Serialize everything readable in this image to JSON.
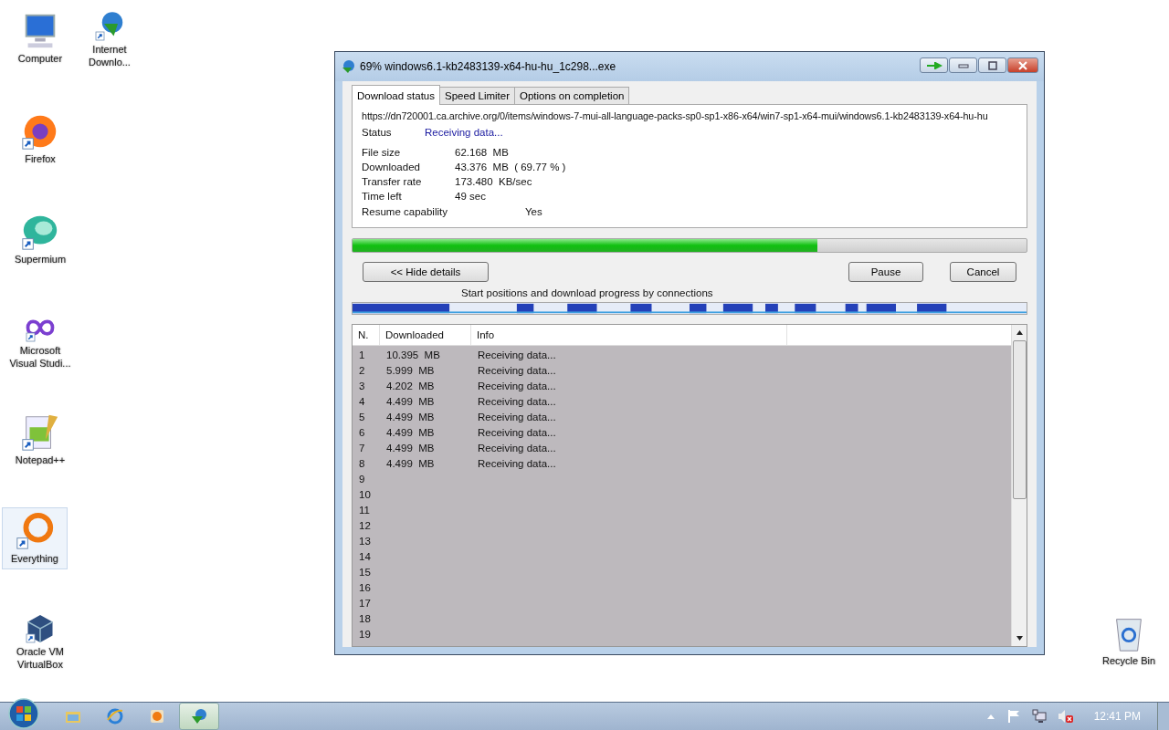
{
  "desktop_icons": [
    {
      "label": "Computer",
      "kind": "computer",
      "selected": false
    },
    {
      "label": "Internet Downlo...",
      "kind": "globe",
      "selected": false
    },
    {
      "label": "Firefox",
      "kind": "firefox",
      "selected": false
    },
    {
      "label": "Supermium",
      "kind": "supermium",
      "selected": false
    },
    {
      "label": "Microsoft Visual Studi...",
      "kind": "infinity",
      "selected": false
    },
    {
      "label": "Notepad++",
      "kind": "notepad",
      "selected": false
    },
    {
      "label": "Everything",
      "kind": "ring",
      "selected": true
    },
    {
      "label": "Oracle VM VirtualBox",
      "kind": "cube",
      "selected": false
    },
    {
      "label": "Recycle Bin",
      "kind": "bin",
      "selected": false
    }
  ],
  "window": {
    "title": "69% windows6.1-kb2483139-x64-hu-hu_1c298...exe"
  },
  "tabs": [
    {
      "label": "Download status",
      "selected": true
    },
    {
      "label": "Speed Limiter",
      "selected": false
    },
    {
      "label": "Options on completion",
      "selected": false
    }
  ],
  "url": "https://dn720001.ca.archive.org/0/items/windows-7-mui-all-language-packs-sp0-sp1-x86-x64/win7-sp1-x64-mui/windows6.1-kb2483139-x64-hu-hu",
  "status": {
    "label": "Status",
    "value": "Receiving data..."
  },
  "details": [
    {
      "label": "File size",
      "value": "62.168  MB"
    },
    {
      "label": "Downloaded",
      "value": "43.376  MB  ( 69.77 % )"
    },
    {
      "label": "Transfer rate",
      "value": "173.480  KB/sec"
    },
    {
      "label": "Time left",
      "value": "49 sec"
    }
  ],
  "resume": {
    "label": "Resume capability",
    "value": "Yes"
  },
  "progress": {
    "level": 0.69
  },
  "buttons": {
    "hide_details": "<< Hide details",
    "pause": "Pause",
    "cancel": "Cancel"
  },
  "connections_caption": "Start positions and download progress by connections",
  "table": {
    "columns": [
      "N.",
      "Downloaded",
      "Info"
    ],
    "rows": [
      {
        "n": "1",
        "downloaded": "10.395  MB",
        "info": "Receiving data..."
      },
      {
        "n": "2",
        "downloaded": "5.999  MB",
        "info": "Receiving data..."
      },
      {
        "n": "3",
        "downloaded": "4.202  MB",
        "info": "Receiving data..."
      },
      {
        "n": "4",
        "downloaded": "4.499  MB",
        "info": "Receiving data..."
      },
      {
        "n": "5",
        "downloaded": "4.499  MB",
        "info": "Receiving data..."
      },
      {
        "n": "6",
        "downloaded": "4.499  MB",
        "info": "Receiving data..."
      },
      {
        "n": "7",
        "downloaded": "4.499  MB",
        "info": "Receiving data..."
      },
      {
        "n": "8",
        "downloaded": "4.499  MB",
        "info": "Receiving data..."
      },
      {
        "n": "9"
      },
      {
        "n": "10"
      },
      {
        "n": "11"
      },
      {
        "n": "12"
      },
      {
        "n": "13"
      },
      {
        "n": "14"
      },
      {
        "n": "15"
      },
      {
        "n": "16"
      },
      {
        "n": "17"
      },
      {
        "n": "18"
      },
      {
        "n": "19"
      }
    ]
  },
  "taskbar": {
    "apps": [
      {
        "kind": "folder",
        "selected": false
      },
      {
        "kind": "ie",
        "selected": false
      },
      {
        "kind": "media",
        "selected": false
      },
      {
        "kind": "idm",
        "selected": true
      }
    ],
    "clock": "12:41 PM"
  }
}
